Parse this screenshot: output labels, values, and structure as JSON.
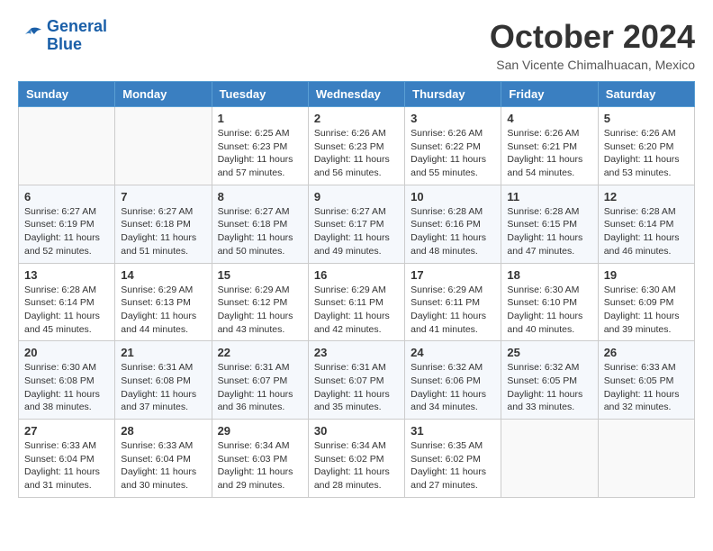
{
  "header": {
    "logo": {
      "line1": "General",
      "line2": "Blue"
    },
    "title": "October 2024",
    "subtitle": "San Vicente Chimalhuacan, Mexico"
  },
  "weekdays": [
    "Sunday",
    "Monday",
    "Tuesday",
    "Wednesday",
    "Thursday",
    "Friday",
    "Saturday"
  ],
  "weeks": [
    [
      {
        "day": "",
        "info": ""
      },
      {
        "day": "",
        "info": ""
      },
      {
        "day": "1",
        "info": "Sunrise: 6:25 AM\nSunset: 6:23 PM\nDaylight: 11 hours and 57 minutes."
      },
      {
        "day": "2",
        "info": "Sunrise: 6:26 AM\nSunset: 6:23 PM\nDaylight: 11 hours and 56 minutes."
      },
      {
        "day": "3",
        "info": "Sunrise: 6:26 AM\nSunset: 6:22 PM\nDaylight: 11 hours and 55 minutes."
      },
      {
        "day": "4",
        "info": "Sunrise: 6:26 AM\nSunset: 6:21 PM\nDaylight: 11 hours and 54 minutes."
      },
      {
        "day": "5",
        "info": "Sunrise: 6:26 AM\nSunset: 6:20 PM\nDaylight: 11 hours and 53 minutes."
      }
    ],
    [
      {
        "day": "6",
        "info": "Sunrise: 6:27 AM\nSunset: 6:19 PM\nDaylight: 11 hours and 52 minutes."
      },
      {
        "day": "7",
        "info": "Sunrise: 6:27 AM\nSunset: 6:18 PM\nDaylight: 11 hours and 51 minutes."
      },
      {
        "day": "8",
        "info": "Sunrise: 6:27 AM\nSunset: 6:18 PM\nDaylight: 11 hours and 50 minutes."
      },
      {
        "day": "9",
        "info": "Sunrise: 6:27 AM\nSunset: 6:17 PM\nDaylight: 11 hours and 49 minutes."
      },
      {
        "day": "10",
        "info": "Sunrise: 6:28 AM\nSunset: 6:16 PM\nDaylight: 11 hours and 48 minutes."
      },
      {
        "day": "11",
        "info": "Sunrise: 6:28 AM\nSunset: 6:15 PM\nDaylight: 11 hours and 47 minutes."
      },
      {
        "day": "12",
        "info": "Sunrise: 6:28 AM\nSunset: 6:14 PM\nDaylight: 11 hours and 46 minutes."
      }
    ],
    [
      {
        "day": "13",
        "info": "Sunrise: 6:28 AM\nSunset: 6:14 PM\nDaylight: 11 hours and 45 minutes."
      },
      {
        "day": "14",
        "info": "Sunrise: 6:29 AM\nSunset: 6:13 PM\nDaylight: 11 hours and 44 minutes."
      },
      {
        "day": "15",
        "info": "Sunrise: 6:29 AM\nSunset: 6:12 PM\nDaylight: 11 hours and 43 minutes."
      },
      {
        "day": "16",
        "info": "Sunrise: 6:29 AM\nSunset: 6:11 PM\nDaylight: 11 hours and 42 minutes."
      },
      {
        "day": "17",
        "info": "Sunrise: 6:29 AM\nSunset: 6:11 PM\nDaylight: 11 hours and 41 minutes."
      },
      {
        "day": "18",
        "info": "Sunrise: 6:30 AM\nSunset: 6:10 PM\nDaylight: 11 hours and 40 minutes."
      },
      {
        "day": "19",
        "info": "Sunrise: 6:30 AM\nSunset: 6:09 PM\nDaylight: 11 hours and 39 minutes."
      }
    ],
    [
      {
        "day": "20",
        "info": "Sunrise: 6:30 AM\nSunset: 6:08 PM\nDaylight: 11 hours and 38 minutes."
      },
      {
        "day": "21",
        "info": "Sunrise: 6:31 AM\nSunset: 6:08 PM\nDaylight: 11 hours and 37 minutes."
      },
      {
        "day": "22",
        "info": "Sunrise: 6:31 AM\nSunset: 6:07 PM\nDaylight: 11 hours and 36 minutes."
      },
      {
        "day": "23",
        "info": "Sunrise: 6:31 AM\nSunset: 6:07 PM\nDaylight: 11 hours and 35 minutes."
      },
      {
        "day": "24",
        "info": "Sunrise: 6:32 AM\nSunset: 6:06 PM\nDaylight: 11 hours and 34 minutes."
      },
      {
        "day": "25",
        "info": "Sunrise: 6:32 AM\nSunset: 6:05 PM\nDaylight: 11 hours and 33 minutes."
      },
      {
        "day": "26",
        "info": "Sunrise: 6:33 AM\nSunset: 6:05 PM\nDaylight: 11 hours and 32 minutes."
      }
    ],
    [
      {
        "day": "27",
        "info": "Sunrise: 6:33 AM\nSunset: 6:04 PM\nDaylight: 11 hours and 31 minutes."
      },
      {
        "day": "28",
        "info": "Sunrise: 6:33 AM\nSunset: 6:04 PM\nDaylight: 11 hours and 30 minutes."
      },
      {
        "day": "29",
        "info": "Sunrise: 6:34 AM\nSunset: 6:03 PM\nDaylight: 11 hours and 29 minutes."
      },
      {
        "day": "30",
        "info": "Sunrise: 6:34 AM\nSunset: 6:02 PM\nDaylight: 11 hours and 28 minutes."
      },
      {
        "day": "31",
        "info": "Sunrise: 6:35 AM\nSunset: 6:02 PM\nDaylight: 11 hours and 27 minutes."
      },
      {
        "day": "",
        "info": ""
      },
      {
        "day": "",
        "info": ""
      }
    ]
  ]
}
